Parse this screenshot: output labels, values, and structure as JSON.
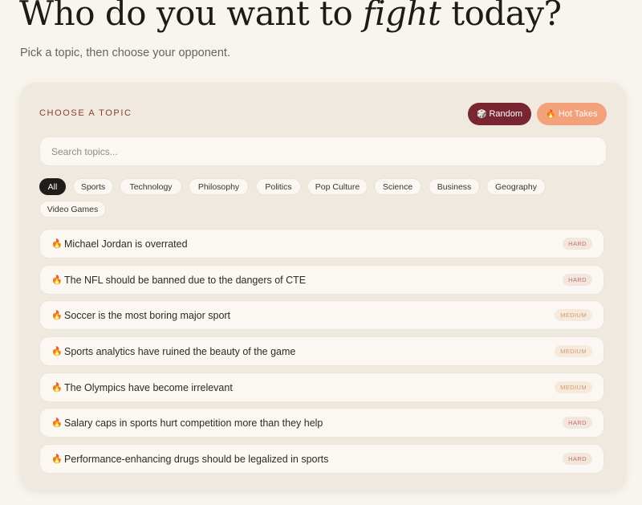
{
  "page": {
    "title_prefix": "Who do you want to ",
    "title_emphasis": "fight",
    "title_suffix": " today?",
    "subtitle": "Pick a topic, then choose your opponent."
  },
  "panel": {
    "section_label": "CHOOSE A TOPIC",
    "random_label": "Random",
    "random_icon": "dice-icon",
    "hot_takes_label": "Hot Takes",
    "hot_takes_icon": "flame-icon",
    "search_placeholder": "Search topics..."
  },
  "categories": [
    {
      "label": "All",
      "active": true
    },
    {
      "label": "Sports",
      "active": false
    },
    {
      "label": "Technology",
      "active": false
    },
    {
      "label": "Philosophy",
      "active": false
    },
    {
      "label": "Politics",
      "active": false
    },
    {
      "label": "Pop Culture",
      "active": false
    },
    {
      "label": "Science",
      "active": false
    },
    {
      "label": "Business",
      "active": false
    },
    {
      "label": "Geography",
      "active": false
    },
    {
      "label": "Video Games",
      "active": false
    }
  ],
  "topics": [
    {
      "text": "Michael Jordan is overrated",
      "difficulty": "HARD"
    },
    {
      "text": "The NFL should be banned due to the dangers of CTE",
      "difficulty": "HARD"
    },
    {
      "text": "Soccer is the most boring major sport",
      "difficulty": "MEDIUM"
    },
    {
      "text": "Sports analytics have ruined the beauty of the game",
      "difficulty": "MEDIUM"
    },
    {
      "text": "The Olympics have become irrelevant",
      "difficulty": "MEDIUM"
    },
    {
      "text": "Salary caps in sports hurt competition more than they help",
      "difficulty": "HARD"
    },
    {
      "text": "Performance-enhancing drugs should be legalized in sports",
      "difficulty": "HARD"
    }
  ],
  "colors": {
    "background": "#f8f5ef",
    "panel": "#efe9df",
    "random_button": "#7a2630",
    "hot_takes_button": "#f3a17b",
    "active_chip": "#1f1c1a",
    "accent_label": "#8a3d34"
  }
}
